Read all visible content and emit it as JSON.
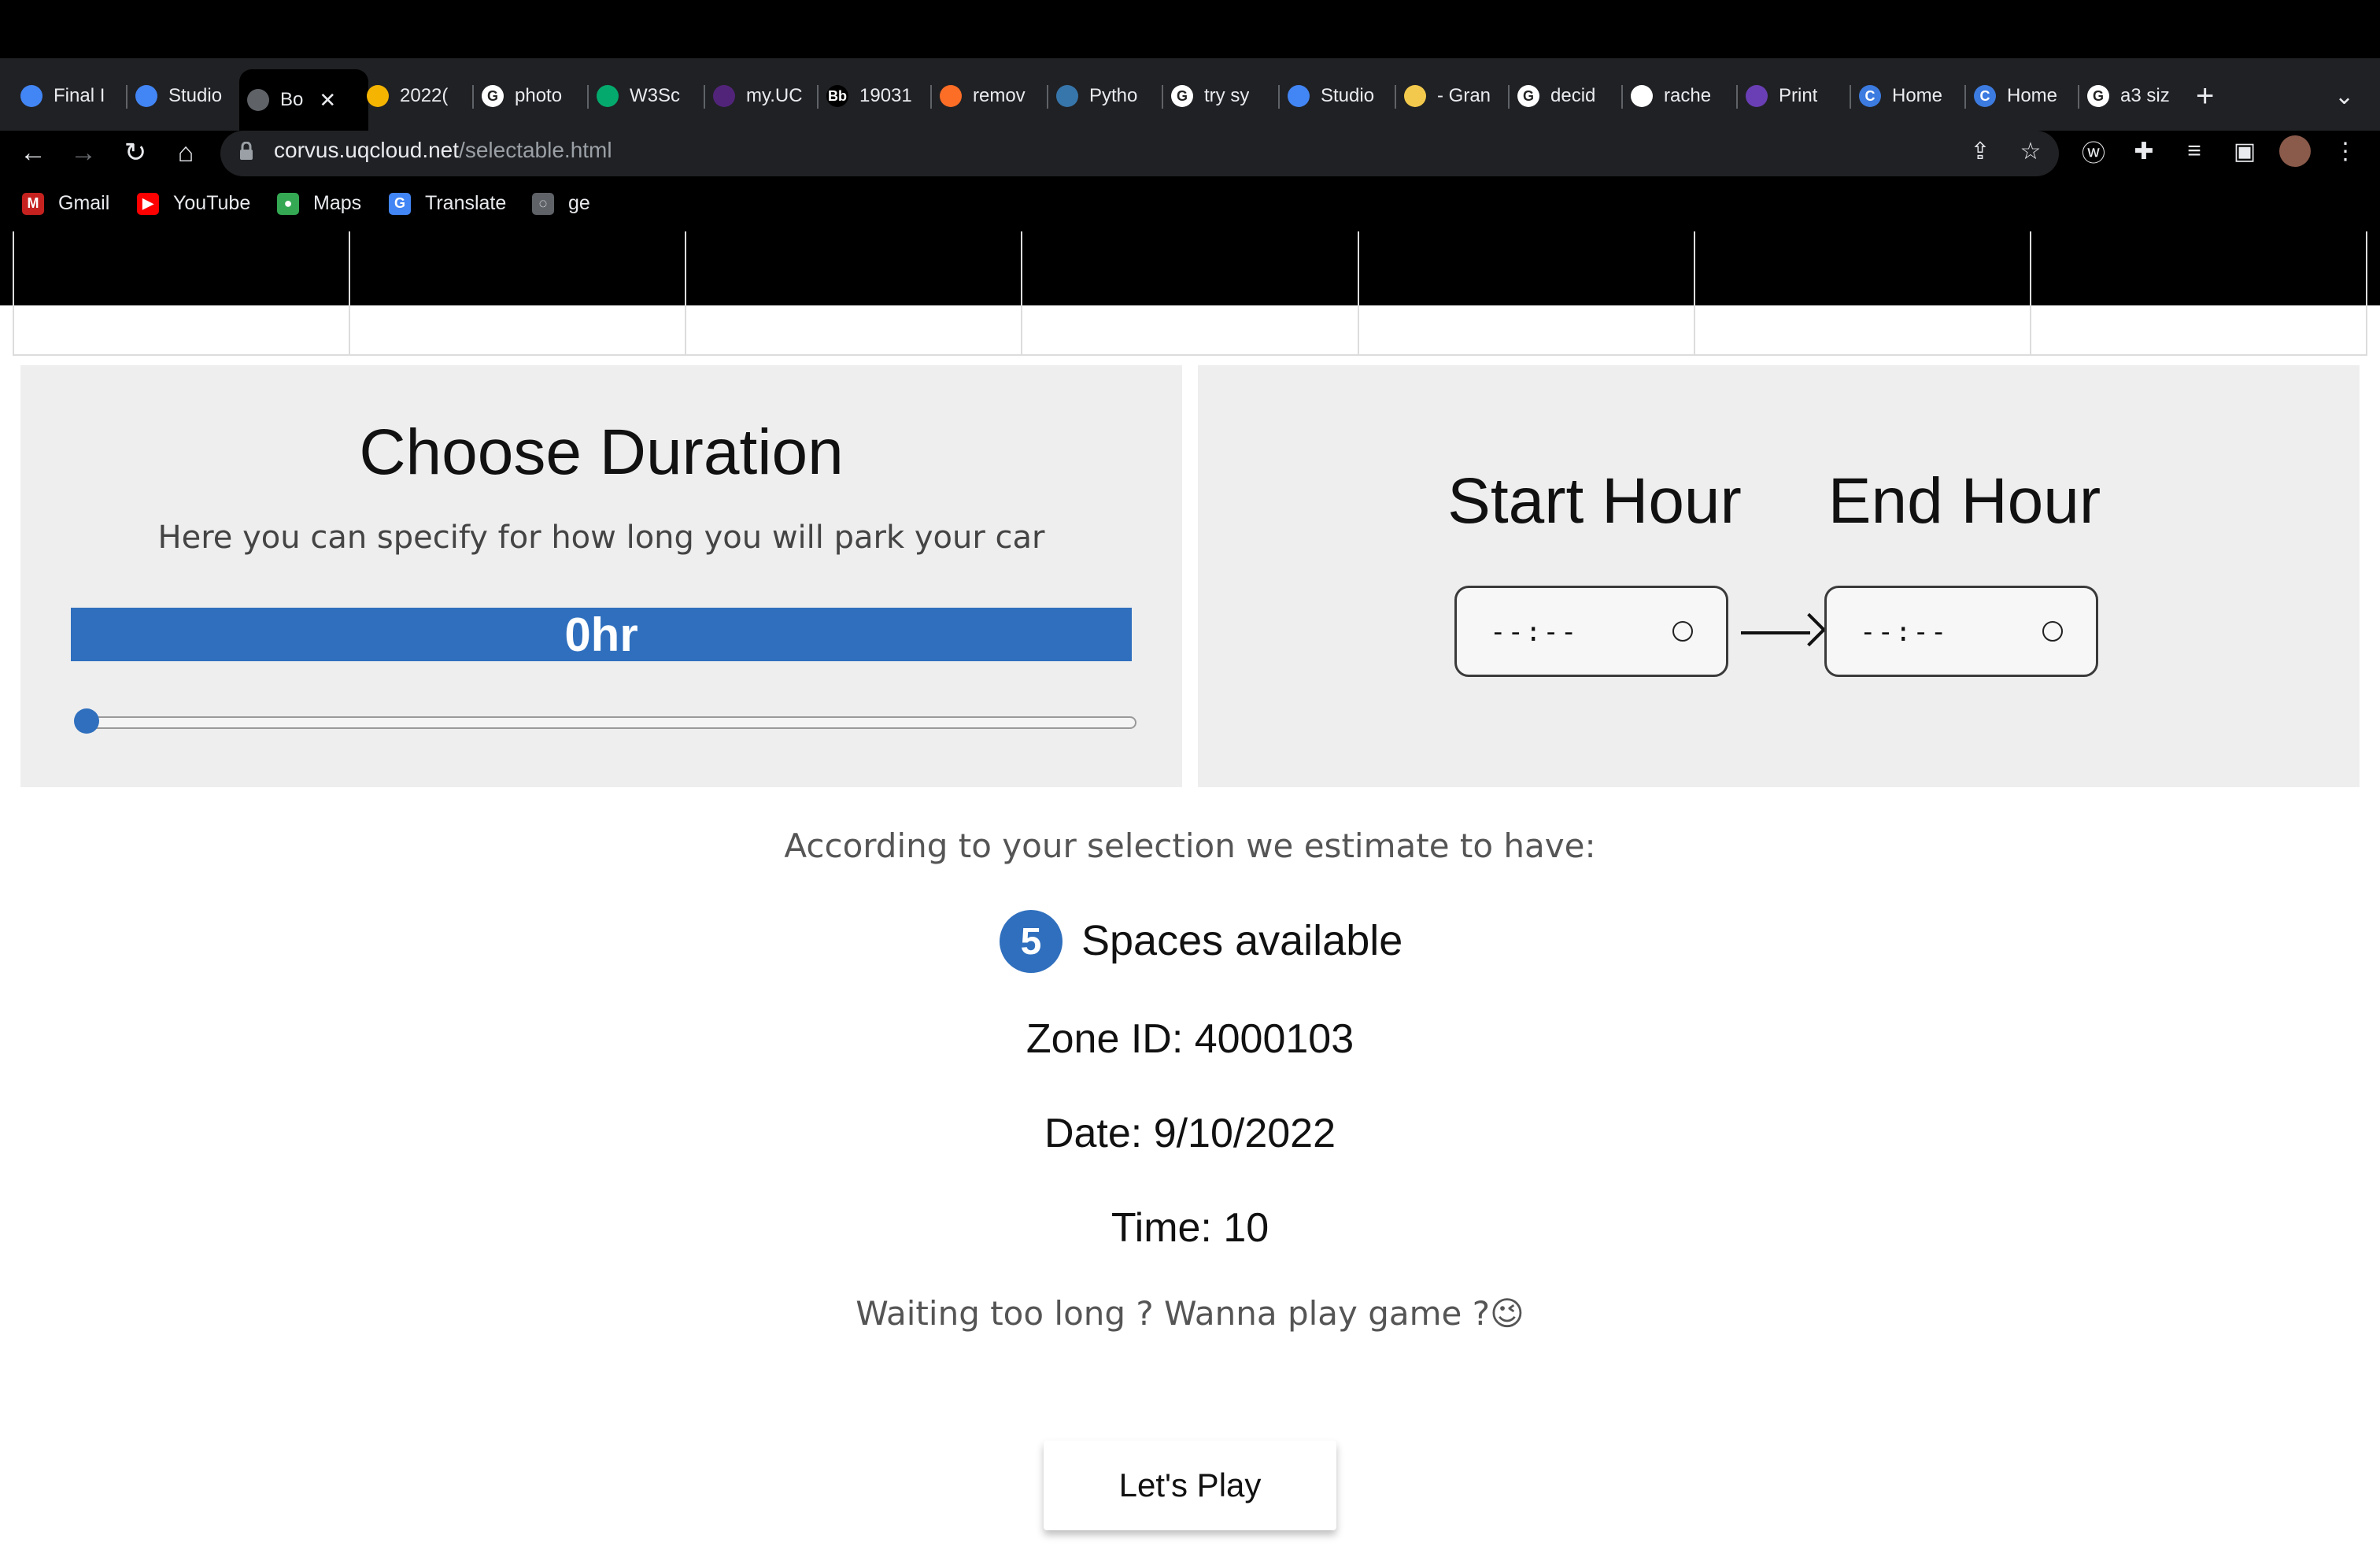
{
  "browser": {
    "tabs": [
      {
        "label": "Final I",
        "icon": "docs-icon"
      },
      {
        "label": "Studio",
        "icon": "docs-icon"
      },
      {
        "label": "Bo",
        "icon": "globe-icon",
        "active": true
      },
      {
        "label": "2022(",
        "icon": "slides-icon"
      },
      {
        "label": "photo",
        "icon": "google-icon"
      },
      {
        "label": "W3Sc",
        "icon": "w3schools-icon"
      },
      {
        "label": "my.UC",
        "icon": "uq-icon"
      },
      {
        "label": "19031",
        "icon": "blackboard-icon"
      },
      {
        "label": "remov",
        "icon": "gitlab-icon"
      },
      {
        "label": "Pytho",
        "icon": "python-icon"
      },
      {
        "label": "try sy",
        "icon": "google-icon"
      },
      {
        "label": "Studio",
        "icon": "docs-icon"
      },
      {
        "label": "- Gran",
        "icon": "grammarly-icon"
      },
      {
        "label": "decid",
        "icon": "google-icon"
      },
      {
        "label": "rache",
        "icon": "github-icon"
      },
      {
        "label": "Print",
        "icon": "print-icon"
      },
      {
        "label": "Home",
        "icon": "c-icon"
      },
      {
        "label": "Home",
        "icon": "c-icon"
      },
      {
        "label": "a3 siz",
        "icon": "google-icon"
      }
    ],
    "url_host": "corvus.uqcloud.net",
    "url_path": "/selectable.html",
    "bookmarks": [
      {
        "label": "Gmail",
        "icon": "gmail-icon"
      },
      {
        "label": "YouTube",
        "icon": "youtube-icon"
      },
      {
        "label": "Maps",
        "icon": "maps-icon"
      },
      {
        "label": "Translate",
        "icon": "translate-icon"
      },
      {
        "label": "ge",
        "icon": "globe-icon"
      }
    ]
  },
  "duration": {
    "title": "Choose Duration",
    "subtitle": "Here you can specify for how long you will park your car",
    "value_label": "0hr",
    "slider_value": 0
  },
  "hours": {
    "start_label": "Start Hour",
    "end_label": "End Hour",
    "start_placeholder": "--:--",
    "end_placeholder": "--:--"
  },
  "estimate": {
    "intro": "According to your selection we estimate to have:",
    "spaces_count": "5",
    "spaces_label": "Spaces available",
    "zone": "Zone ID: 4000103",
    "date": "Date: 9/10/2022",
    "time": "Time: 10"
  },
  "game": {
    "prompt": "Waiting too long ? Wanna play game ?😉",
    "button_label": "Let's Play"
  },
  "colors": {
    "accent": "#2f6fbe",
    "panel_bg": "#eeeeee"
  }
}
